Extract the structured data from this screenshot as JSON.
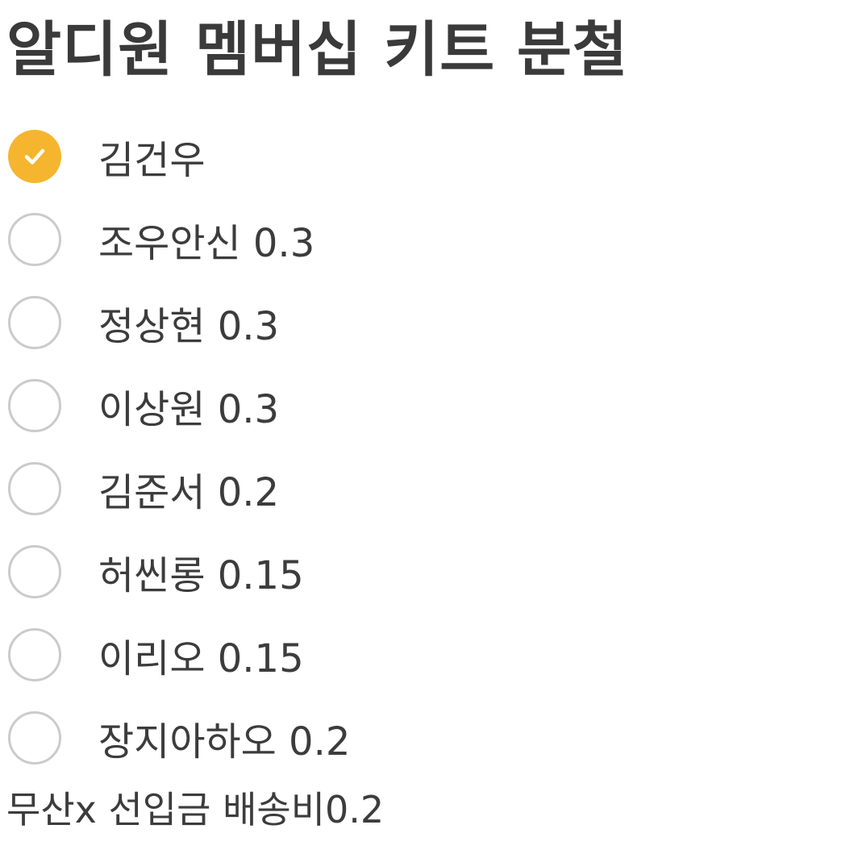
{
  "title": "알디원 멤버십 키트 분철",
  "options": [
    {
      "label": "김건우",
      "checked": true
    },
    {
      "label": "조우안신 0.3",
      "checked": false
    },
    {
      "label": "정상현 0.3",
      "checked": false
    },
    {
      "label": "이상원 0.3",
      "checked": false
    },
    {
      "label": "김준서 0.2",
      "checked": false
    },
    {
      "label": "허씬롱 0.15",
      "checked": false
    },
    {
      "label": "이리오 0.15",
      "checked": false
    },
    {
      "label": "장지아하오 0.2",
      "checked": false
    }
  ],
  "footer": "무산x 선입금 배송비0.2",
  "colors": {
    "accent": "#f5b52e",
    "unchecked_border": "#cbcbcb",
    "text": "#3c3c3c"
  },
  "icons": {
    "checked": "checkmark-icon",
    "unchecked": "empty-circle-icon"
  }
}
